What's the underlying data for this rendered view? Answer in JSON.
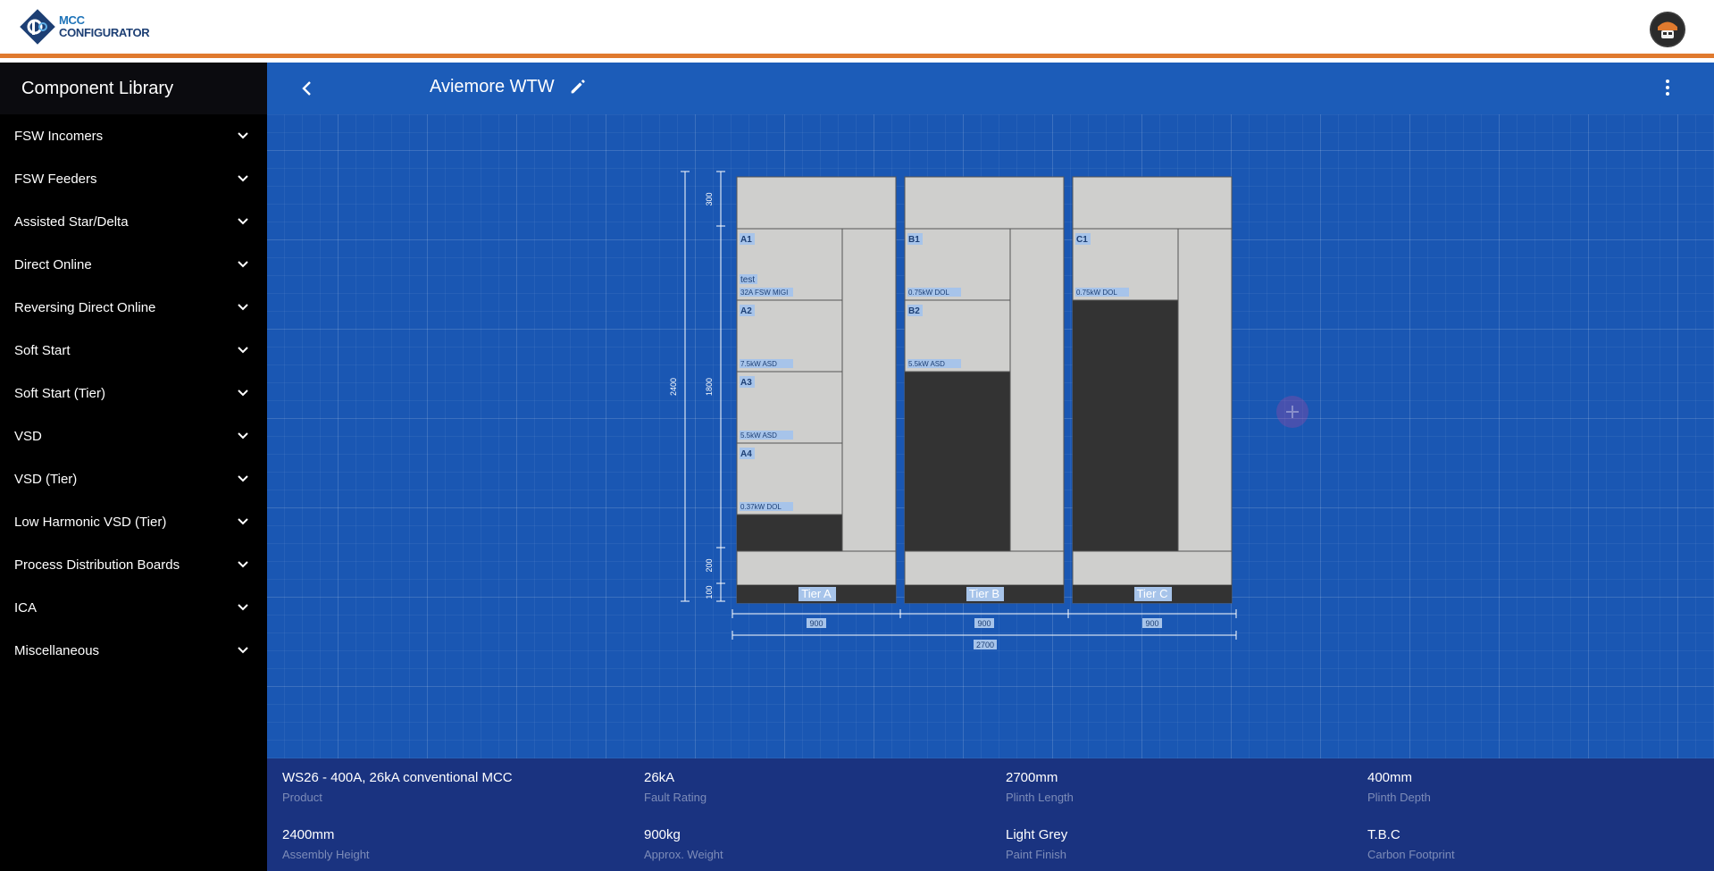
{
  "app": {
    "logo_line1": "MCC",
    "logo_line2": "CONFIGURATOR"
  },
  "sidebar": {
    "title": "Component Library",
    "items": [
      {
        "label": "FSW Incomers"
      },
      {
        "label": "FSW Feeders"
      },
      {
        "label": "Assisted Star/Delta"
      },
      {
        "label": "Direct Online"
      },
      {
        "label": "Reversing Direct Online"
      },
      {
        "label": "Soft Start"
      },
      {
        "label": "Soft Start (Tier)"
      },
      {
        "label": "VSD"
      },
      {
        "label": "VSD (Tier)"
      },
      {
        "label": "Low Harmonic VSD (Tier)"
      },
      {
        "label": "Process Distribution Boards"
      },
      {
        "label": "ICA"
      },
      {
        "label": "Miscellaneous"
      }
    ]
  },
  "toolbar": {
    "project_name": "Aviemore WTW"
  },
  "icons": {
    "back": "chevron-left-icon",
    "edit": "pencil-icon",
    "more": "more-vertical-icon",
    "expand": "chevron-down-icon",
    "add": "plus-icon"
  },
  "colors": {
    "accent": "#e07a2e",
    "canvas": "#1a57b3",
    "info_panel": "#1a3380",
    "panel_grey": "#cfcfcd",
    "panel_dark": "#333333"
  },
  "drawing": {
    "dims": {
      "total_height": "2400",
      "top": "300",
      "middle": "1800",
      "bottom": "200",
      "plinth": "100",
      "total_width": "2700"
    },
    "tiers": [
      {
        "label": "Tier A",
        "width": "900",
        "units": [
          {
            "id": "A1",
            "name": "test",
            "desc": "32A FSW MIGI"
          },
          {
            "id": "A2",
            "name": "",
            "desc": "7.5kW ASD"
          },
          {
            "id": "A3",
            "name": "",
            "desc": "5.5kW ASD"
          },
          {
            "id": "A4",
            "name": "",
            "desc": "0.37kW DOL"
          }
        ]
      },
      {
        "label": "Tier B",
        "width": "900",
        "units": [
          {
            "id": "B1",
            "name": "",
            "desc": "0.75kW DOL"
          },
          {
            "id": "B2",
            "name": "",
            "desc": "5.5kW ASD"
          }
        ]
      },
      {
        "label": "Tier C",
        "width": "900",
        "units": [
          {
            "id": "C1",
            "name": "",
            "desc": "0.75kW DOL"
          }
        ]
      }
    ]
  },
  "info": [
    {
      "value": "WS26 - 400A, 26kA conventional MCC",
      "label": "Product"
    },
    {
      "value": "26kA",
      "label": "Fault Rating"
    },
    {
      "value": "2700mm",
      "label": "Plinth Length"
    },
    {
      "value": "400mm",
      "label": "Plinth Depth"
    },
    {
      "value": "2400mm",
      "label": "Assembly Height"
    },
    {
      "value": "900kg",
      "label": "Approx. Weight"
    },
    {
      "value": "Light Grey",
      "label": "Paint Finish"
    },
    {
      "value": "T.B.C",
      "label": "Carbon Footprint"
    }
  ]
}
